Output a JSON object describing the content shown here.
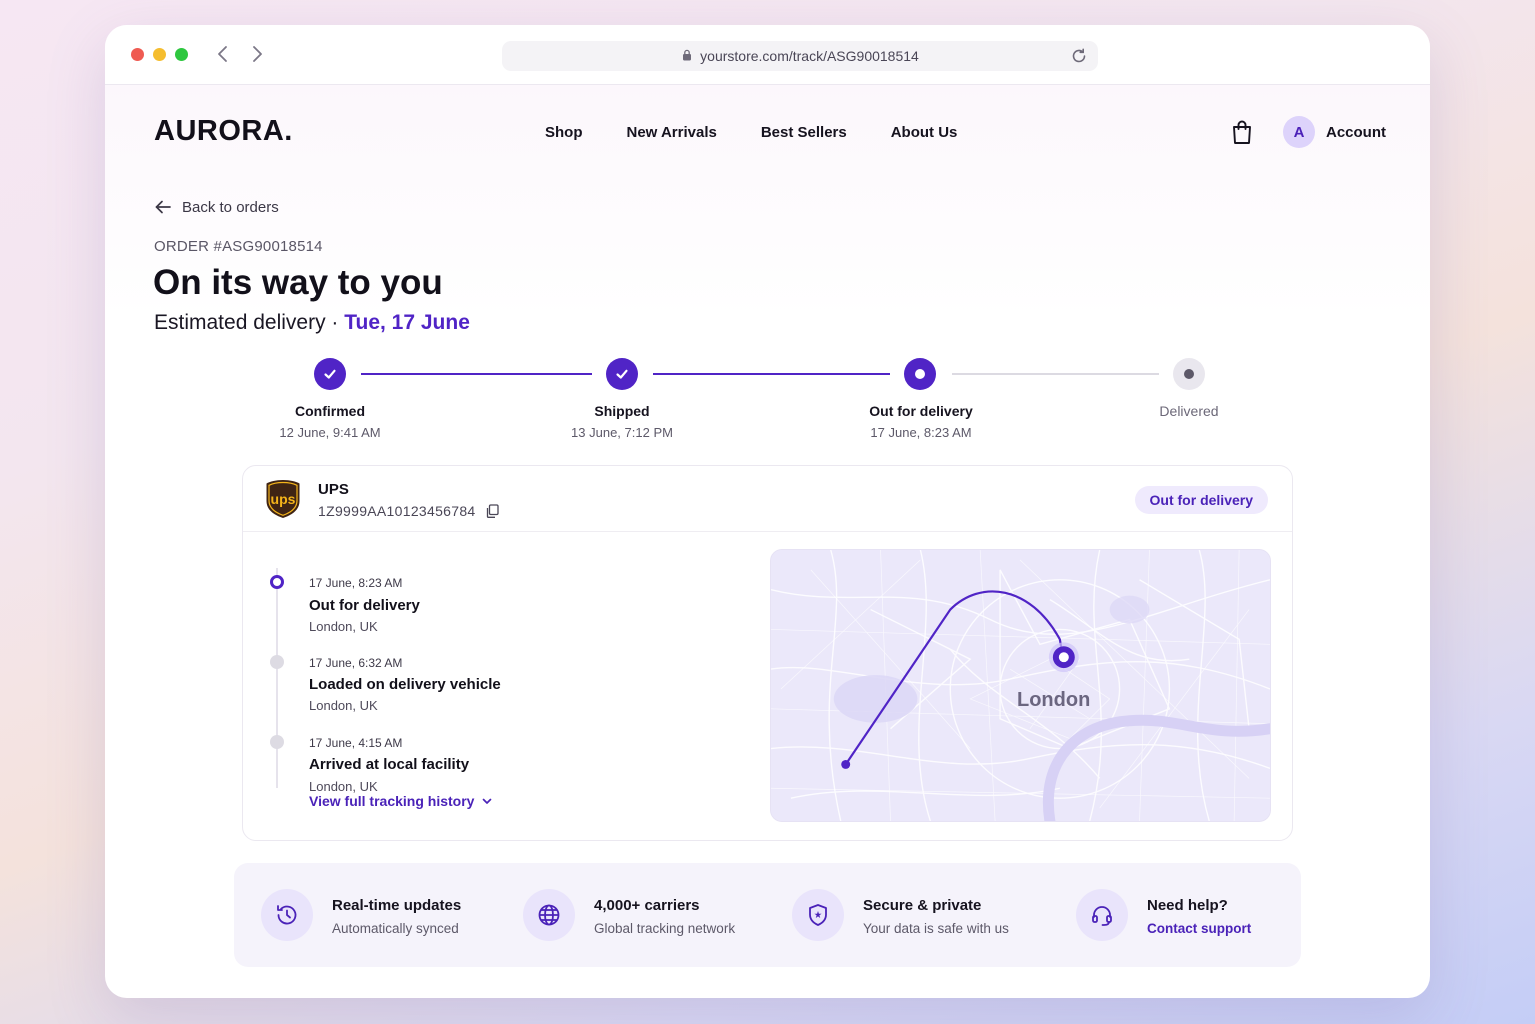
{
  "browser": {
    "url": "yourstore.com/track/ASG90018514"
  },
  "header": {
    "logo": "AURORA.",
    "nav": [
      "Shop",
      "New Arrivals",
      "Best Sellers",
      "About Us"
    ],
    "avatar_initial": "A",
    "account_label": "Account"
  },
  "order": {
    "back_label": "Back to orders",
    "order_number": "ORDER #ASG90018514",
    "headline": "On its way to you",
    "eta_prefix": "Estimated delivery · ",
    "eta_date": "Tue, 17 June"
  },
  "progress": [
    {
      "label": "Confirmed",
      "date": "12 June, 9:41 AM",
      "state": "done"
    },
    {
      "label": "Shipped",
      "date": "13 June, 7:12 PM",
      "state": "done"
    },
    {
      "label": "Out for delivery",
      "date": "17 June, 8:23 AM",
      "state": "current"
    },
    {
      "label": "Delivered",
      "date": "",
      "state": "todo"
    }
  ],
  "shipment": {
    "carrier": "UPS",
    "logo_text": "ups",
    "tracking_number": "1Z9999AA10123456784",
    "status": "Out for delivery",
    "events": [
      {
        "time": "17 June, 8:23 AM",
        "title": "Out for delivery",
        "location": "London, UK"
      },
      {
        "time": "17 June, 6:32 AM",
        "title": "Loaded on delivery vehicle",
        "location": "London, UK"
      },
      {
        "time": "17 June, 4:15 AM",
        "title": "Arrived at local facility",
        "location": "London, UK"
      }
    ],
    "history_link": "View full tracking history",
    "map_label": "London"
  },
  "features": [
    {
      "icon": "clock-refresh-icon",
      "title": "Real-time updates",
      "subtitle": "Automatically synced"
    },
    {
      "icon": "globe-icon",
      "title": "4,000+ carriers",
      "subtitle": "Global tracking network"
    },
    {
      "icon": "shield-icon",
      "title": "Secure & private",
      "subtitle": "Your data is safe with us"
    },
    {
      "icon": "headset-icon",
      "title": "Need help?",
      "subtitle": "Contact support"
    }
  ],
  "colors": {
    "accent": "#5024c6",
    "accent_soft": "#efeafd",
    "ups_brown": "#3f2414",
    "ups_gold": "#f4b41a"
  }
}
